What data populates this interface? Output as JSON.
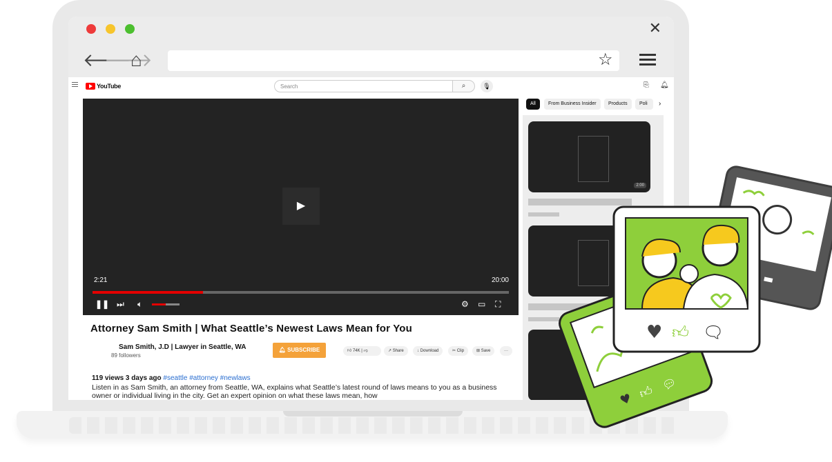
{
  "browser": {
    "url": "",
    "window_dots": [
      "#ee3b3b",
      "#f7c52c",
      "#4cbf2f"
    ]
  },
  "youtube": {
    "logo_text": "YouTube",
    "search_placeholder": "Search",
    "player": {
      "current_time": "2:21",
      "duration": "20:00",
      "progress": 0.265,
      "volume": 0.5
    },
    "video_title": "Attorney Sam Smith | What Seattle’s Newest Laws Mean for You",
    "channel_name": "Sam Smith, J.D | Lawyer in Seattle, WA",
    "followers": "89 followers",
    "subscribe_label": "SUBSCRIBE",
    "actions": {
      "likes": "74K",
      "share": "Share",
      "download": "Download",
      "clip": "Clip",
      "save": "Save",
      "more": "···"
    },
    "description_meta": "119 views 3 days ago",
    "description_tags": "#seattle #attorney #newlaws",
    "description": "Listen in as Sam Smith, an attorney from Seattle, WA, explains what Seattle’s latest round of laws means to you as a business owner or individual living in the city. Get an expert opinion on what these laws mean, how",
    "chips": [
      "All",
      "From Business Insider",
      "Products",
      "Poli"
    ],
    "sidebar_duration": "2:00"
  },
  "colors": {
    "accent_green": "#8ecf3b",
    "subscribe_orange": "#f4a23a",
    "progress_red": "#e40000"
  }
}
